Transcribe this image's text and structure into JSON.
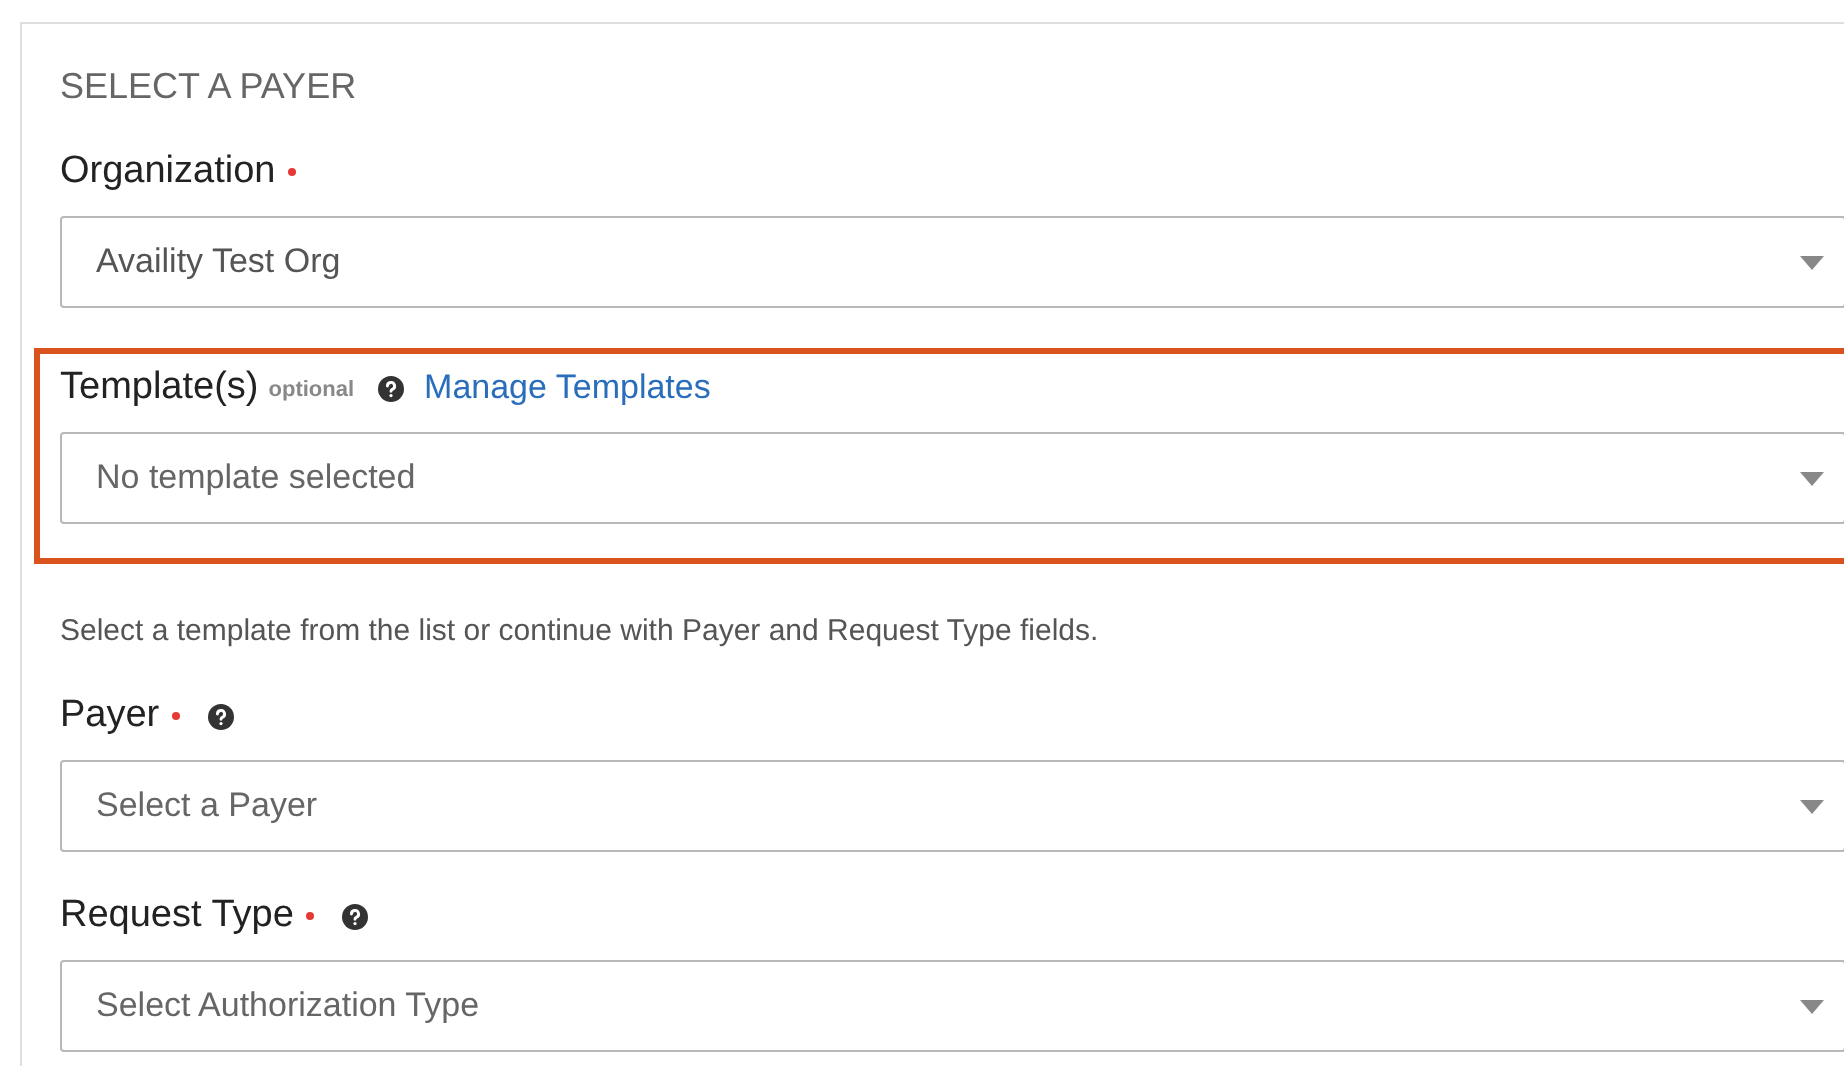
{
  "panel": {
    "title": "SELECT A PAYER"
  },
  "sections": [
    {
      "kind": "field",
      "label": "Organization",
      "required": true,
      "help": false,
      "value": "Availity Test Org",
      "highlighted": false
    },
    {
      "kind": "field",
      "label": "Template(s)",
      "optional": "optional",
      "required": false,
      "help": true,
      "link": "Manage Templates",
      "placeholder": "No template selected",
      "highlighted": true
    },
    {
      "kind": "note",
      "text": "Select a template from the list or continue with Payer and Request Type fields."
    },
    {
      "kind": "field",
      "label": "Payer",
      "required": true,
      "help": true,
      "placeholder": "Select a Payer",
      "highlighted": false
    },
    {
      "kind": "field",
      "label": "Request Type",
      "required": true,
      "help": true,
      "placeholder": "Select Authorization Type",
      "highlighted": false
    }
  ]
}
